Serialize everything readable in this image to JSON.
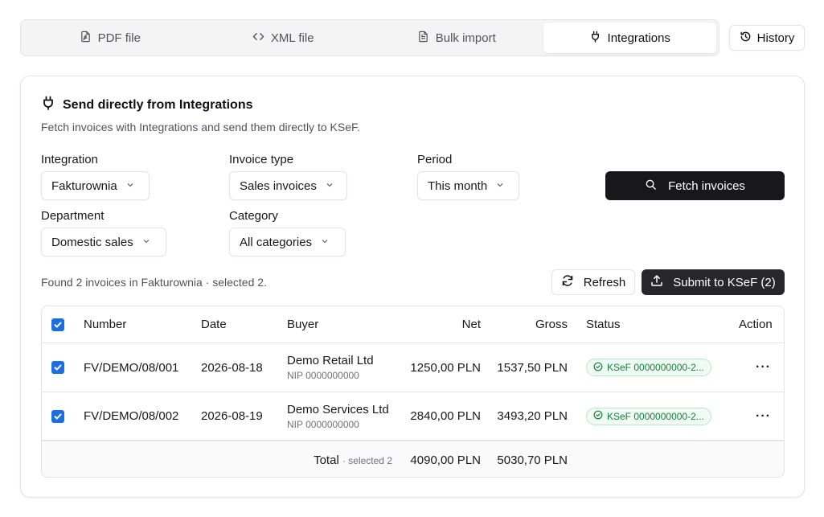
{
  "tabs": [
    {
      "label": "PDF file",
      "icon": "file-pdf-icon"
    },
    {
      "label": "XML file",
      "icon": "code-icon"
    },
    {
      "label": "Bulk import",
      "icon": "file-list-icon"
    },
    {
      "label": "Integrations",
      "icon": "plug-icon",
      "active": true
    }
  ],
  "history_label": "History",
  "card": {
    "title": "Send directly from Integrations",
    "subtitle": "Fetch invoices with Integrations and send them directly to KSeF."
  },
  "filters": {
    "integration": {
      "label": "Integration",
      "value": "Fakturownia"
    },
    "invoice_type": {
      "label": "Invoice type",
      "value": "Sales invoices"
    },
    "period": {
      "label": "Period",
      "value": "This month"
    },
    "department": {
      "label": "Department",
      "value": "Domestic sales"
    },
    "category": {
      "label": "Category",
      "value": "All categories"
    }
  },
  "fetch_label": "Fetch invoices",
  "found_text": "Found 2 invoices in Fakturownia",
  "selected_text": "· selected 2.",
  "refresh_label": "Refresh",
  "submit_label": "Submit to KSeF (2)",
  "table": {
    "headers": {
      "number": "Number",
      "date": "Date",
      "buyer": "Buyer",
      "net": "Net",
      "gross": "Gross",
      "status": "Status",
      "action": "Action"
    },
    "rows": [
      {
        "number": "FV/DEMO/08/001",
        "date": "2026-08-18",
        "buyer": "Demo Retail Ltd",
        "nip": "NIP 0000000000",
        "net": "1250,00 PLN",
        "gross": "1537,50 PLN",
        "status": "KSeF 0000000000-2...",
        "checked": true
      },
      {
        "number": "FV/DEMO/08/002",
        "date": "2026-08-19",
        "buyer": "Demo Services Ltd",
        "nip": "NIP 0000000000",
        "net": "2840,00 PLN",
        "gross": "3493,20 PLN",
        "status": "KSeF 0000000000-2...",
        "checked": true
      }
    ],
    "total": {
      "label": "Total",
      "selected": "· selected 2",
      "net": "4090,00 PLN",
      "gross": "5030,70 PLN"
    }
  },
  "colors": {
    "primary_dark": "#18181b",
    "checkbox_blue": "#1d6fe0",
    "status_green": "#15803d"
  }
}
